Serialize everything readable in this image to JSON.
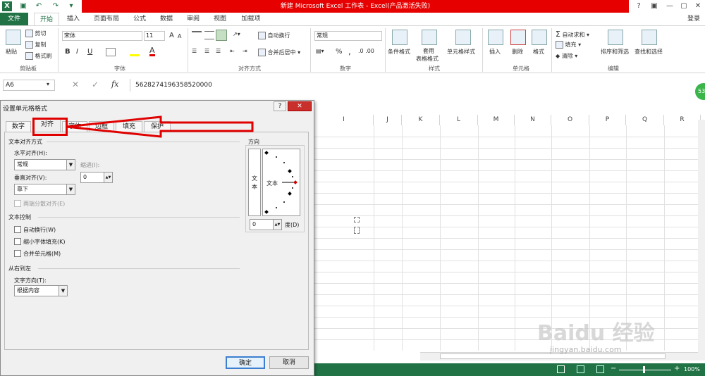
{
  "window": {
    "title": "新建 Microsoft Excel 工作表 - Excel(产品激活失败)",
    "controls": [
      "?",
      "▣",
      "—",
      "▢",
      "✕"
    ]
  },
  "ribbon_tabs": [
    "文件",
    "开始",
    "插入",
    "页面布局",
    "公式",
    "数据",
    "审阅",
    "视图",
    "加载项"
  ],
  "login": "登录",
  "clipboard": {
    "paste": "粘贴",
    "cut": "剪切",
    "copy": "复制",
    "format_painter": "格式刷",
    "label": "剪贴板"
  },
  "font": {
    "name": "宋体",
    "size": "11",
    "bold": "B",
    "italic": "I",
    "underline": "U",
    "label": "字体",
    "grow": "A",
    "shrink": "A"
  },
  "alignment": {
    "wrap": "自动换行",
    "merge": "合并后居中",
    "label": "对齐方式"
  },
  "number": {
    "format": "常规",
    "label": "数字",
    "percent": "%",
    "comma": ","
  },
  "styles": {
    "conditional": "条件格式",
    "table1": "套用",
    "table2": "表格格式",
    "cell": "单元格样式",
    "label": "样式"
  },
  "cells": {
    "insert": "插入",
    "delete": "删除",
    "format": "格式",
    "label": "单元格"
  },
  "editing": {
    "autosum": "自动求和",
    "fill": "填充",
    "clear": "清除",
    "sort": "排序和筛选",
    "find": "查找和选择",
    "label": "编辑"
  },
  "formula_bar": {
    "name_box": "A6",
    "fx": "fx",
    "value": "5628274196358520000"
  },
  "columns": [
    "I",
    "J",
    "K",
    "L",
    "M",
    "N",
    "O",
    "P",
    "Q",
    "R"
  ],
  "badge": "53",
  "dialog": {
    "title": "设置单元格格式",
    "help": "?",
    "close": "✕",
    "tabs": [
      "数字",
      "对齐",
      "字体",
      "边框",
      "填充",
      "保护"
    ],
    "text_align_section": "文本对齐方式",
    "horizontal_label": "水平对齐(H):",
    "horizontal_value": "常规",
    "indent_label": "缩进(I):",
    "indent_value": "0",
    "vertical_label": "垂直对齐(V):",
    "vertical_value": "靠下",
    "distributed": "两端分散对齐(E)",
    "text_control_section": "文本控制",
    "wrap_text": "自动换行(W)",
    "shrink": "缩小字体填充(K)",
    "merge": "合并单元格(M)",
    "rtl_section": "从右到左",
    "direction_label": "文字方向(T):",
    "direction_value": "根据内容",
    "orientation_label": "方向",
    "vertical_text": "文本",
    "orientation_text": "文本",
    "degrees_value": "0",
    "degrees_label": "度(D)",
    "ok": "确定",
    "cancel": "取消"
  },
  "status": {
    "zoom": "100%"
  },
  "watermark": {
    "brand": "Baidu 经验",
    "url": "jingyan.baidu.com"
  }
}
